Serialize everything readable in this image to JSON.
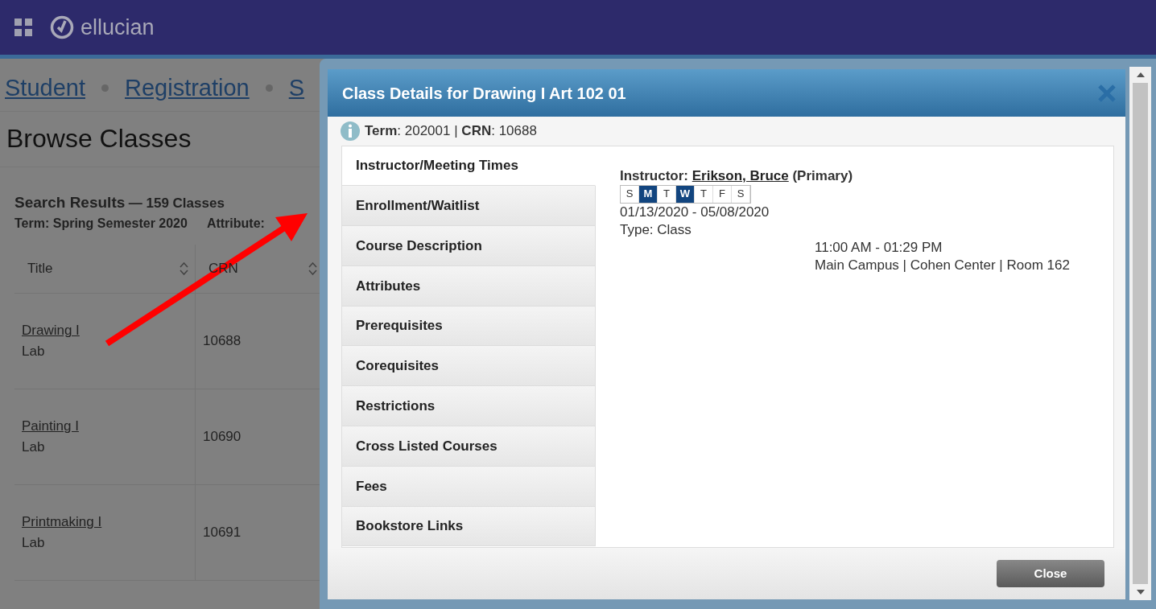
{
  "header": {
    "logo_text": "ellucian"
  },
  "breadcrumbs": [
    "Student",
    "Registration",
    "S"
  ],
  "page_title": "Browse Classes",
  "results": {
    "heading": "Search Results",
    "count": "— 159 Classes",
    "term": "Term: Spring Semester 2020",
    "attribute": "Attribute:"
  },
  "table": {
    "columns": [
      "Title",
      "CRN"
    ],
    "rows": [
      {
        "title": "Drawing I",
        "type": "Lab",
        "crn": "10688"
      },
      {
        "title": "Painting I",
        "type": "Lab",
        "crn": "10690"
      },
      {
        "title": "Printmaking I",
        "type": "Lab",
        "crn": "10691"
      }
    ]
  },
  "dialog": {
    "title": "Class Details for Drawing I Art 102 01",
    "info": "**Term**: 202001 | **CRN**: 10688",
    "tabs": [
      {
        "label": "Instructor/Meeting Times",
        "selected": true
      },
      {
        "label": "Enrollment/Waitlist",
        "selected": false
      },
      {
        "label": "Course Description",
        "selected": false
      },
      {
        "label": "Attributes",
        "selected": false
      },
      {
        "label": "Prerequisites",
        "selected": false
      },
      {
        "label": "Corequisites",
        "selected": false
      },
      {
        "label": "Restrictions",
        "selected": false
      },
      {
        "label": "Cross Listed Courses",
        "selected": false
      },
      {
        "label": "Fees",
        "selected": false
      },
      {
        "label": "Bookstore Links",
        "selected": false
      }
    ],
    "instructor": {
      "label": "Instructor:",
      "name": "Erikson, Bruce",
      "role": "(Primary)"
    },
    "days": [
      {
        "label": "S",
        "selected": false
      },
      {
        "label": "M",
        "selected": true
      },
      {
        "label": "T",
        "selected": false
      },
      {
        "label": "W",
        "selected": true
      },
      {
        "label": "T",
        "selected": false
      },
      {
        "label": "F",
        "selected": false
      },
      {
        "label": "S",
        "selected": false
      }
    ],
    "dates": "01/13/2020 - 05/08/2020",
    "type": "Type: Class",
    "time": "11:00 AM - 01:29 PM",
    "location": "Main Campus | Cohen Center | Room 162",
    "close_button": "Close"
  }
}
